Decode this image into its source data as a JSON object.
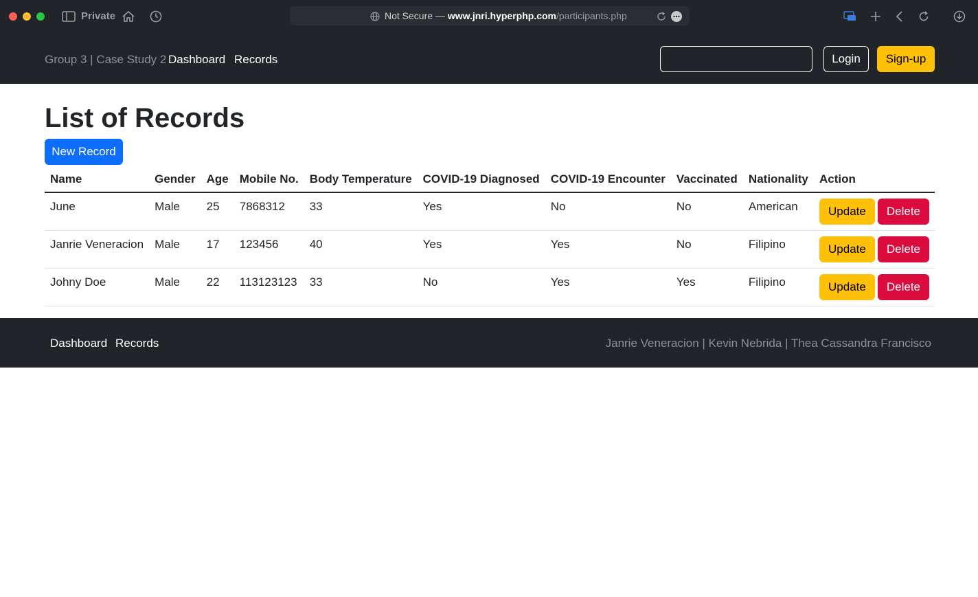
{
  "browser": {
    "private_label": "Private",
    "url_prefix": "Not Secure — ",
    "url_host": "www.jnri.hyperphp.com",
    "url_path": "/participants.php"
  },
  "navbar": {
    "brand": "Group 3 | Case Study 2",
    "links": [
      "Dashboard",
      "Records"
    ],
    "search_value": "",
    "login_label": "Login",
    "signup_label": "Sign-up"
  },
  "main": {
    "title": "List of Records",
    "new_record_label": "New Record",
    "columns": [
      "Name",
      "Gender",
      "Age",
      "Mobile No.",
      "Body Temperature",
      "COVID-19 Diagnosed",
      "COVID-19 Encounter",
      "Vaccinated",
      "Nationality",
      "Action"
    ],
    "rows": [
      {
        "name": "June",
        "gender": "Male",
        "age": "25",
        "mobile": "7868312",
        "temp": "33",
        "diagnosed": "Yes",
        "encounter": "No",
        "vaccinated": "No",
        "nationality": "American"
      },
      {
        "name": "Janrie Veneracion",
        "gender": "Male",
        "age": "17",
        "mobile": "123456",
        "temp": "40",
        "diagnosed": "Yes",
        "encounter": "Yes",
        "vaccinated": "No",
        "nationality": "Filipino"
      },
      {
        "name": "Johny Doe",
        "gender": "Male",
        "age": "22",
        "mobile": "113123123",
        "temp": "33",
        "diagnosed": "No",
        "encounter": "Yes",
        "vaccinated": "Yes",
        "nationality": "Filipino"
      }
    ],
    "update_label": "Update",
    "delete_label": "Delete"
  },
  "footer": {
    "links": [
      "Dashboard",
      "Records"
    ],
    "credits": "Janrie Veneracion | Kevin Nebrida | Thea Cassandra Francisco"
  },
  "colors": {
    "dark": "#212529",
    "primary": "#0d6efd",
    "warning": "#ffc107",
    "danger": "#dc0b3e"
  }
}
